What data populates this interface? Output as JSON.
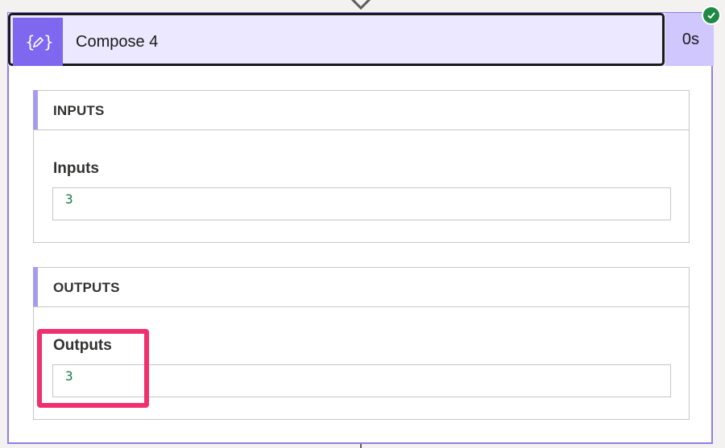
{
  "action": {
    "title": "Compose 4",
    "duration": "0s",
    "icon": "compose-braces-pencil-icon",
    "status": "succeeded"
  },
  "sections": {
    "inputs": {
      "title": "INPUTS",
      "field_label": "Inputs",
      "field_value": "3"
    },
    "outputs": {
      "title": "OUTPUTS",
      "field_label": "Outputs",
      "field_value": "3"
    }
  },
  "colors": {
    "accent": "#8067f0",
    "header_bg": "#ece8ff",
    "success": "#1e8a44",
    "highlight": "#f0306e",
    "value_text": "#117a48"
  }
}
